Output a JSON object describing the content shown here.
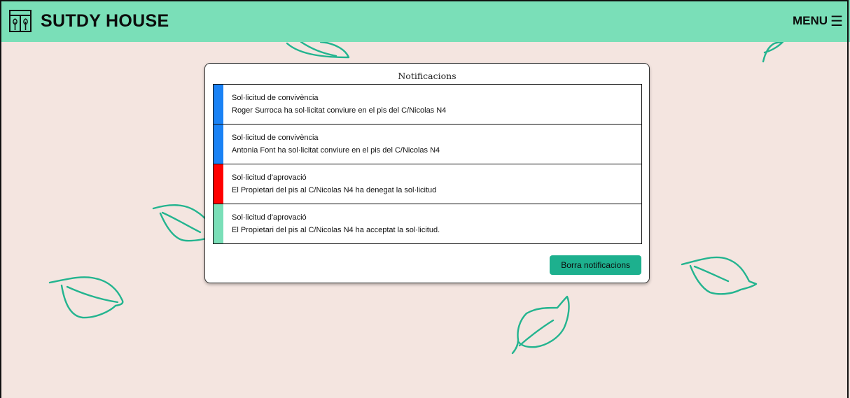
{
  "header": {
    "brand_title": "SUTDY HOUSE",
    "menu_label": "MENU",
    "menu_icon": "☰",
    "background_color": "#7adfb8"
  },
  "page": {
    "background_color": "#f4e5e0",
    "leaf_color": "#23b48f"
  },
  "notifications": {
    "title": "Notificacions",
    "items": [
      {
        "title": "Sol·licitud de convivència",
        "body": "Roger Surroca ha sol·licitat conviure en el pis del C/Nicolas N4",
        "color": "#1a82f5"
      },
      {
        "title": "Sol·licitud de convivència",
        "body": "Antonia Font ha sol·licitat conviure en el pis del C/Nicolas N4",
        "color": "#1a82f5"
      },
      {
        "title": "Sol·licitud d'aprovació",
        "body": "El Propietari del pis al C/Nicolas N4 ha denegat la sol·licitud",
        "color": "#ff0000"
      },
      {
        "title": "Sol·licitud d'aprovació",
        "body": "El Propietari del pis al C/Nicolas N4 ha acceptat la sol·licitud.",
        "color": "#7adfb8"
      }
    ],
    "clear_button_label": "Borra notificacions",
    "clear_button_color": "#1db08e"
  }
}
